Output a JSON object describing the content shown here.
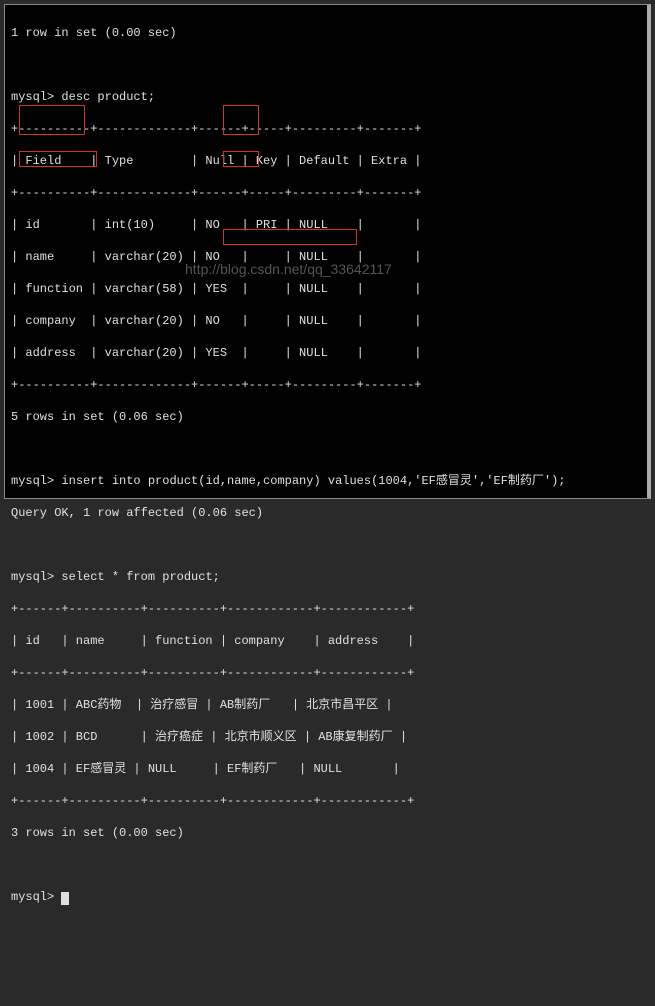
{
  "top_line": "1 row in set (0.00 sec)",
  "prompt": "mysql>",
  "cmd_desc": "desc product;",
  "desc_border_top": "+----------+-------------+------+-----+---------+-------+",
  "desc_header": "| Field    | Type        | Null | Key | Default | Extra |",
  "desc_rows": [
    "| id       | int(10)     | NO   | PRI | NULL    |       |",
    "| name     | varchar(20) | NO   |     | NULL    |       |",
    "| function | varchar(58) | YES  |     | NULL    |       |",
    "| company  | varchar(20) | NO   |     | NULL    |       |",
    "| address  | varchar(20) | YES  |     | NULL    |       |"
  ],
  "desc_result": "5 rows in set (0.06 sec)",
  "cmd_insert": "insert into product(id,name,company) values(1004,'EF感冒灵','EF制药厂');",
  "insert_result": "Query OK, 1 row affected (0.06 sec)",
  "cmd_select": "select * from product;",
  "sel_border_top": "+------+----------+----------+------------+------------+",
  "sel_header": "| id   | name     | function | company    | address    |",
  "sel_rows": [
    "| 1001 | ABC药物  | 治疗感冒 | AB制药厂   | 北京市昌平区 |",
    "| 1002 | BCD      | 治疗癌症 | 北京市顺义区 | AB康复制药厂 |",
    "| 1004 | EF感冒灵 | NULL     | EF制药厂   | NULL       |"
  ],
  "sel_result": "3 rows in set (0.00 sec)",
  "watermark": "http://blog.csdn.net/qq_33642117",
  "chart_data": {
    "type": "table",
    "tables": [
      {
        "title": "desc product",
        "columns": [
          "Field",
          "Type",
          "Null",
          "Key",
          "Default",
          "Extra"
        ],
        "rows": [
          [
            "id",
            "int(10)",
            "NO",
            "PRI",
            "NULL",
            ""
          ],
          [
            "name",
            "varchar(20)",
            "NO",
            "",
            "NULL",
            ""
          ],
          [
            "function",
            "varchar(58)",
            "YES",
            "",
            "NULL",
            ""
          ],
          [
            "company",
            "varchar(20)",
            "NO",
            "",
            "NULL",
            ""
          ],
          [
            "address",
            "varchar(20)",
            "YES",
            "",
            "NULL",
            ""
          ]
        ]
      },
      {
        "title": "select * from product",
        "columns": [
          "id",
          "name",
          "function",
          "company",
          "address"
        ],
        "rows": [
          [
            1001,
            "ABC药物",
            "治疗感冒",
            "AB制药厂",
            "北京市昌平区"
          ],
          [
            1002,
            "BCD",
            "治疗癌症",
            "北京市顺义区",
            "AB康复制药厂"
          ],
          [
            1004,
            "EF感冒灵",
            "NULL",
            "EF制药厂",
            "NULL"
          ]
        ]
      }
    ],
    "insert_statement": {
      "table": "product",
      "columns": [
        "id",
        "name",
        "company"
      ],
      "values": [
        1004,
        "EF感冒灵",
        "EF制药厂"
      ]
    }
  }
}
